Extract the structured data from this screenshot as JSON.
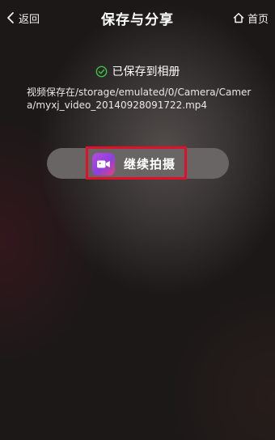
{
  "header": {
    "back_label": "返回",
    "title": "保存与分享",
    "home_label": "首页"
  },
  "status": {
    "saved_label": "已保存到相册",
    "icon": "check-circle-icon",
    "icon_color": "#3cc04c"
  },
  "save_path": "视频保存在/storage/emulated/0/Camera/Camera/myxj_video_20140928091722.mp4",
  "continue_button": {
    "label": "继续拍摄",
    "icon": "video-camera-icon",
    "icon_colors": [
      "#b34ce0",
      "#e2437f"
    ],
    "highlight_color": "#e0102a"
  }
}
